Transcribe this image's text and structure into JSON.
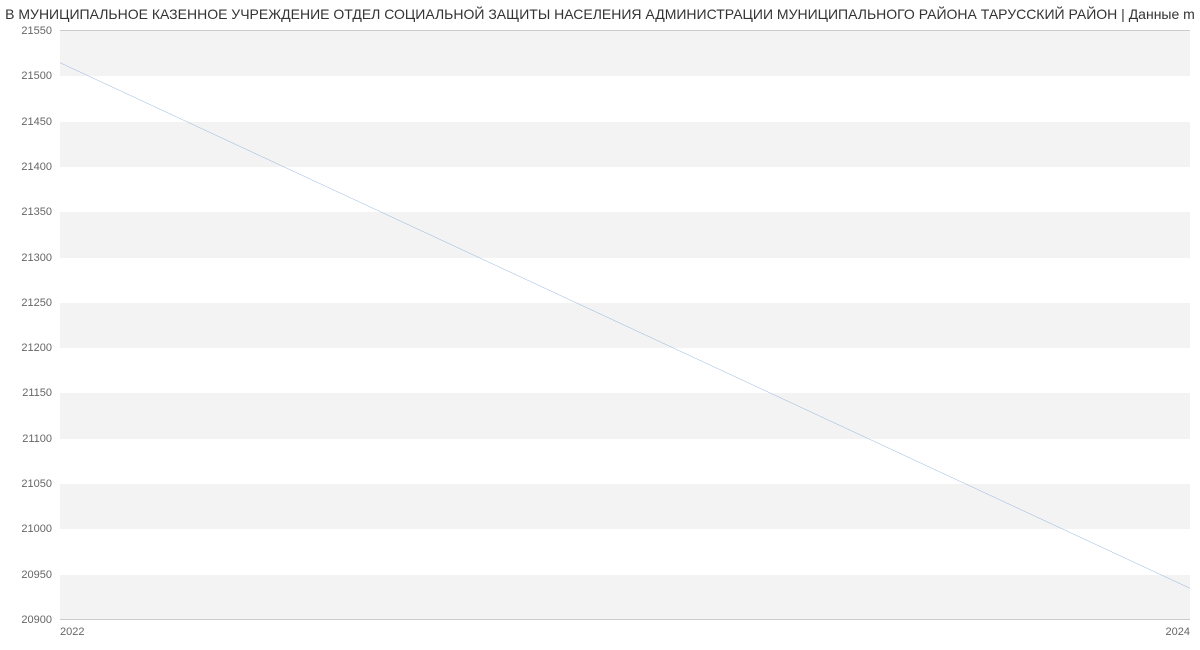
{
  "chart_data": {
    "type": "line",
    "title": " В МУНИЦИПАЛЬНОЕ КАЗЕННОЕ УЧРЕЖДЕНИЕ ОТДЕЛ СОЦИАЛЬНОЙ ЗАЩИТЫ НАСЕЛЕНИЯ АДМИНИСТРАЦИИ МУНИЦИПАЛЬНОГО РАЙОНА ТАРУССКИЙ РАЙОН | Данные m",
    "xlabel": "",
    "ylabel": "",
    "x": [
      2022,
      2024
    ],
    "series": [
      {
        "name": "",
        "values": [
          21515,
          20935
        ],
        "color": "#6795d0"
      }
    ],
    "xlim": [
      2022,
      2024
    ],
    "ylim": [
      20900,
      21550
    ],
    "x_ticks": [
      2022,
      2024
    ],
    "y_ticks": [
      20900,
      20950,
      21000,
      21050,
      21100,
      21150,
      21200,
      21250,
      21300,
      21350,
      21400,
      21450,
      21500,
      21550
    ]
  }
}
